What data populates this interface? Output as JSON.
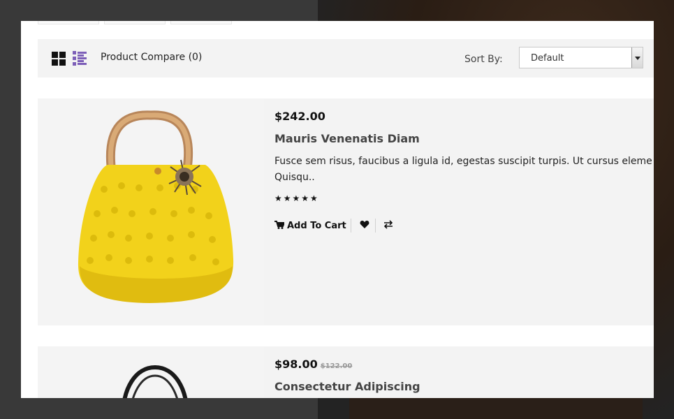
{
  "toolbar": {
    "compare_label": "Product Compare (0)",
    "sort_label": "Sort By:",
    "sort_value": "Default"
  },
  "products": [
    {
      "price": "$242.00",
      "old_price": "",
      "name": "Mauris Venenatis Diam",
      "description_line1": "Fusce sem risus, faucibus a ligula id, egestas suscipit turpis. Ut cursus eleme",
      "description_line2": "Quisqu..",
      "rating": 5,
      "stars": "★★★★★",
      "add_to_cart_label": "Add To Cart",
      "wishlist_icon": "heart-icon",
      "compare_icon": "exchange-icon"
    },
    {
      "price": "$98.00",
      "old_price": "$122.00",
      "name": "Consectetur Adipiscing"
    }
  ],
  "colors": {
    "list_view_accent": "#7d5fb8",
    "toolbar_bg": "#f3f3f3",
    "bag_yellow": "#f2d21b"
  }
}
